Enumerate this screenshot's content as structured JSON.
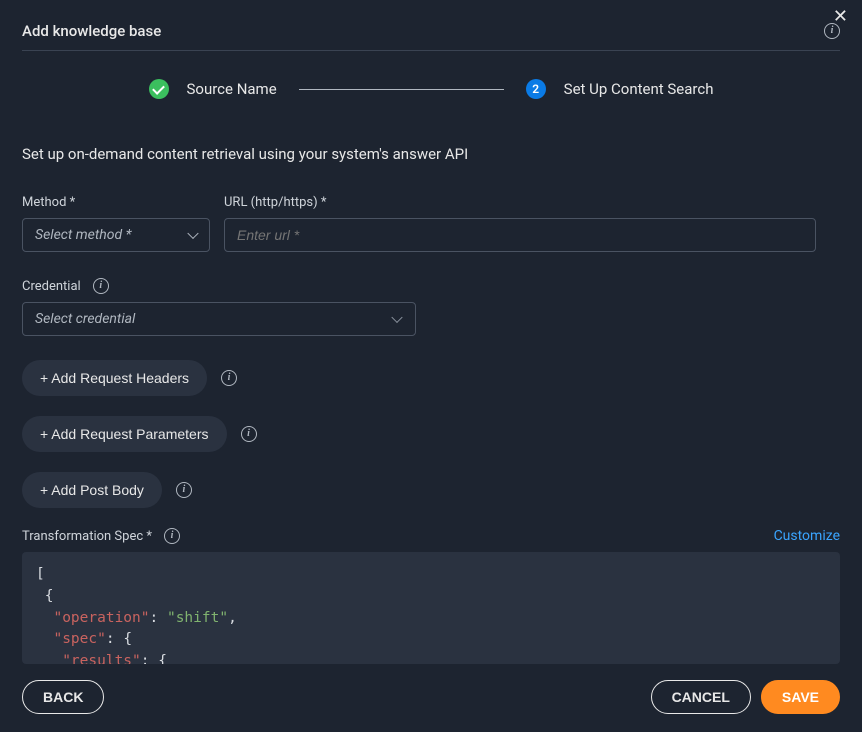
{
  "header": {
    "title": "Add knowledge base"
  },
  "stepper": {
    "step1": {
      "label": "Source Name"
    },
    "step2": {
      "number": "2",
      "label": "Set Up Content Search"
    }
  },
  "intro": "Set up on-demand content retrieval using your system's answer API",
  "fields": {
    "method": {
      "label": "Method *",
      "placeholder": "Select method *"
    },
    "url": {
      "label": "URL (http/https) *",
      "placeholder": "Enter url *"
    },
    "credential": {
      "label": "Credential",
      "placeholder": "Select credential"
    }
  },
  "buttons": {
    "addHeaders": "+ Add Request Headers",
    "addParams": "+ Add Request Parameters",
    "addPost": "+ Add Post Body"
  },
  "spec": {
    "label": "Transformation Spec *",
    "customize": "Customize",
    "code": {
      "l1": "[",
      "l2": " {",
      "k_operation": "\"operation\"",
      "v_operation": "\"shift\"",
      "k_spec": "\"spec\"",
      "k_results": "\"results\""
    }
  },
  "footer": {
    "back": "BACK",
    "cancel": "CANCEL",
    "save": "SAVE"
  }
}
